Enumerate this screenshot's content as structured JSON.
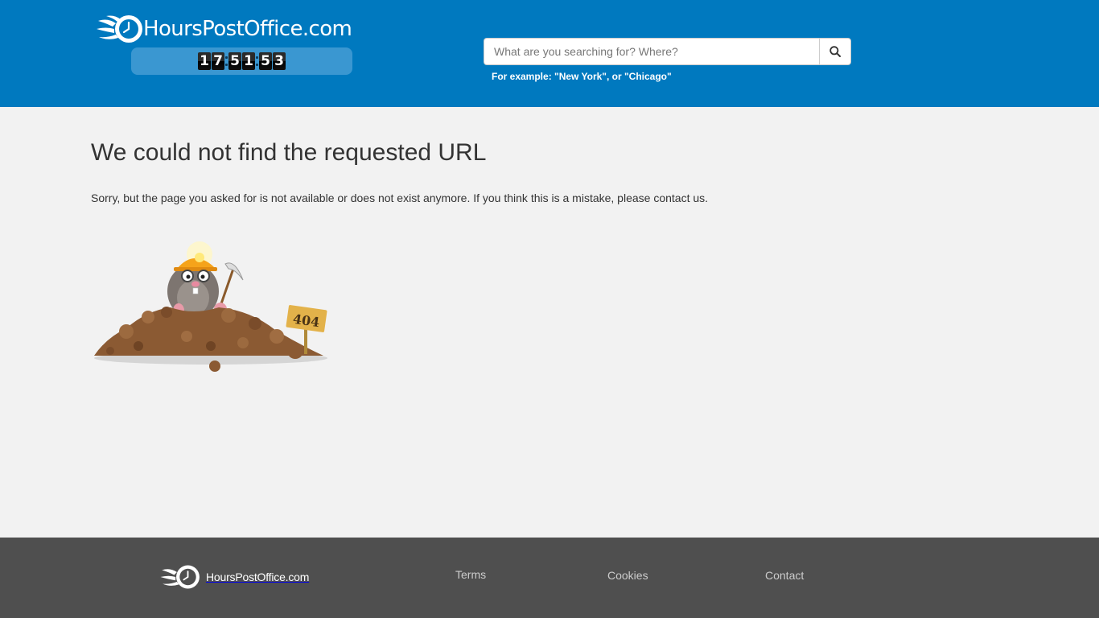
{
  "header": {
    "site_name": "HoursPostOffice.com",
    "clock": {
      "h1": "1",
      "h2": "7",
      "m1": "5",
      "m2": "1",
      "s1": "5",
      "s2": "3"
    },
    "search": {
      "placeholder": "What are you searching for? Where?",
      "value": "",
      "button_icon": "search-icon",
      "example": "For example: \"New York\", or \"Chicago\""
    }
  },
  "main": {
    "title": "We could not find the requested URL",
    "message": "Sorry, but the page you asked for is not available or does not exist anymore. If you think this is a mistake, please contact us.",
    "illustration": {
      "icon": "mole-404-illustration",
      "sign_text": "404"
    }
  },
  "footer": {
    "site_name": "HoursPostOffice.com",
    "links": {
      "terms": "Terms",
      "cookies": "Cookies",
      "contact": "Contact"
    }
  },
  "colors": {
    "header_bg": "#0079bf",
    "clock_bar_bg": "#3a97d1",
    "page_bg": "#f2f2f2",
    "footer_bg": "#4f4f4f",
    "text": "#333333",
    "footer_link": "#cccccc"
  }
}
